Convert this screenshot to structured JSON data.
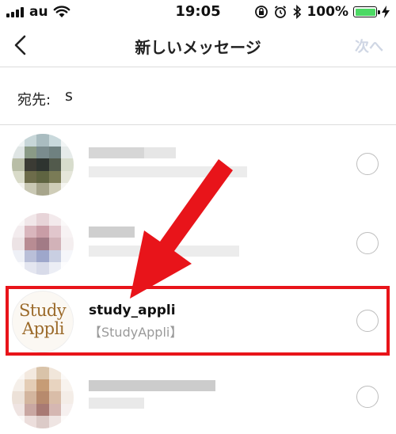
{
  "status_bar": {
    "carrier": "au",
    "time": "19:05",
    "battery_percent": "100%",
    "battery_color": "#4cd964"
  },
  "nav": {
    "title": "新しいメッセージ",
    "next_label": "次へ",
    "back_icon": "chevron-left-icon"
  },
  "to_field": {
    "label": "宛先:",
    "value": "s"
  },
  "list": {
    "highlighted": {
      "name": "study_appli",
      "subtitle": "【StudyAppli】",
      "logo_line1": "Study",
      "logo_line2": "Appli"
    }
  },
  "annotation": {
    "color": "#e8141a"
  }
}
